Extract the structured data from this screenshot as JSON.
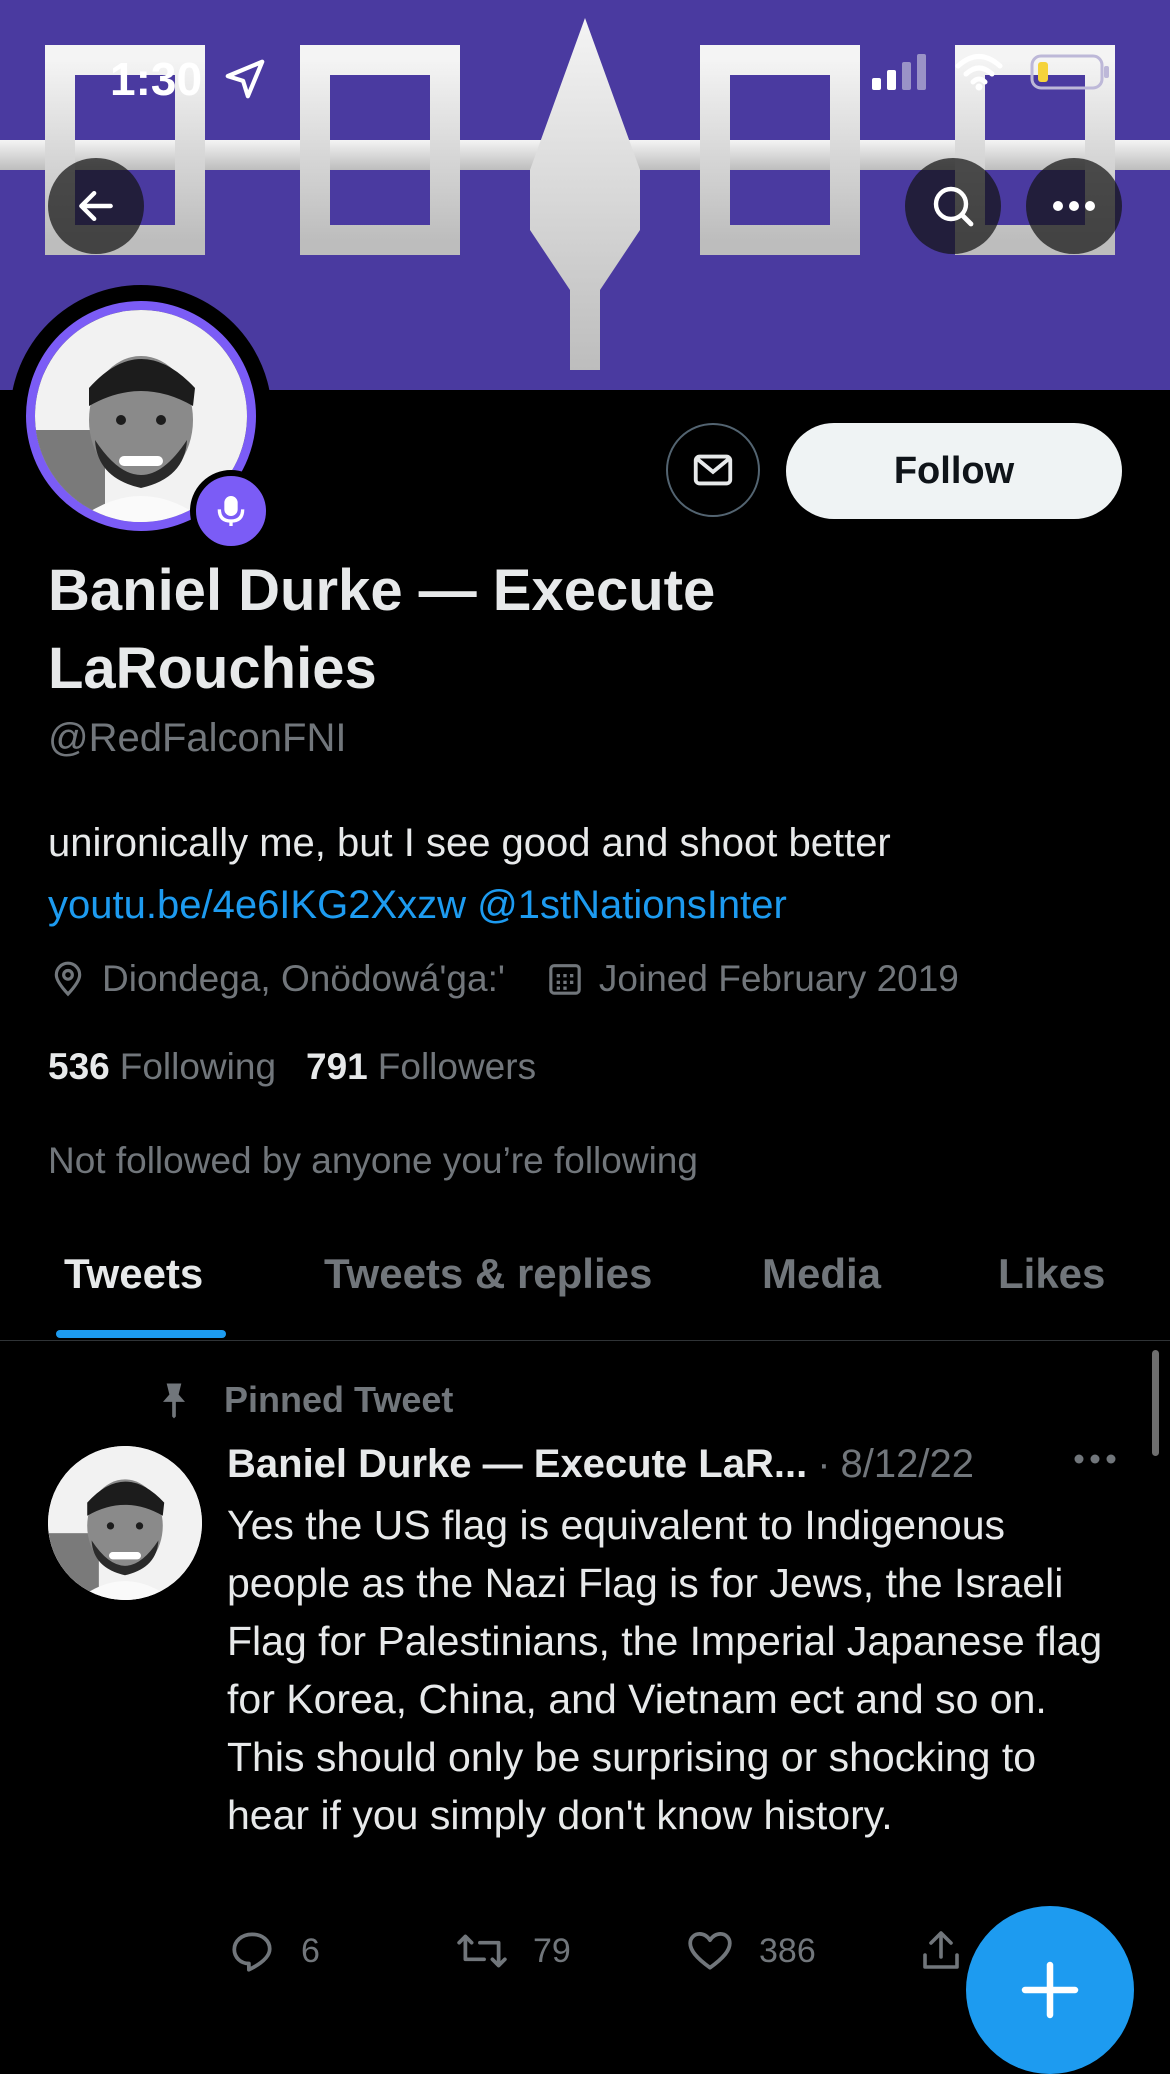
{
  "status_bar": {
    "time": "1:30"
  },
  "header": {
    "back_icon": "arrow-left-icon",
    "search_icon": "search-icon",
    "more_icon": "more-icon"
  },
  "profile": {
    "display_name": "Baniel Durke — Execute LaRouchies",
    "handle": "@RedFalconFNI",
    "bio_text": "unironically me, but I see good and shoot better",
    "bio_link": "youtu.be/4e6IKG2Xxzw",
    "bio_mention": "@1stNationsInter",
    "location": "Diondega, Onödowá'ga:'",
    "joined": "Joined February 2019",
    "following_count": "536",
    "following_label": "Following",
    "followers_count": "791",
    "followers_label": "Followers",
    "not_followed": "Not followed by anyone you’re following"
  },
  "buttons": {
    "follow_label": "Follow"
  },
  "tabs": [
    {
      "label": "Tweets",
      "active": true
    },
    {
      "label": "Tweets & replies",
      "active": false
    },
    {
      "label": "Media",
      "active": false
    },
    {
      "label": "Likes",
      "active": false
    }
  ],
  "pinned_tweet": {
    "pinned_label": "Pinned Tweet",
    "author": "Baniel Durke — Execute LaR...",
    "date": "8/12/22",
    "text": "Yes the US flag is equivalent to Indigenous people as the Nazi Flag is for Jews, the Israeli Flag for Palestinians, the Imperial Japanese flag for Korea, China, and Vietnam ect and so on. This should only be surprising or shocking to hear if you simply don't know history.",
    "replies": "6",
    "retweets": "79",
    "likes": "386"
  },
  "colors": {
    "banner": "#4a3aa0",
    "accent": "#1d9bf0",
    "ring": "#7b5cf6"
  }
}
